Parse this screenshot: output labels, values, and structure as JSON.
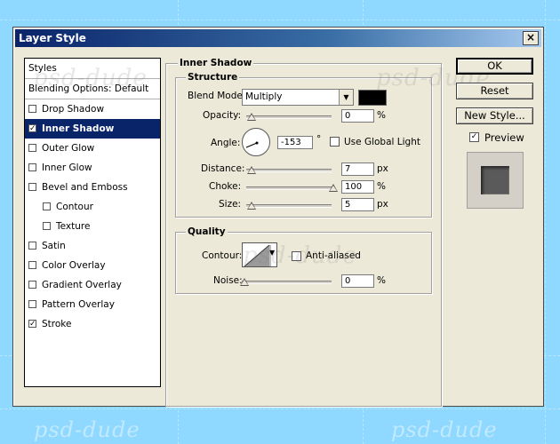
{
  "watermark": "psd-dude",
  "window": {
    "title": "Layer Style",
    "close_symbol": "×"
  },
  "styles_panel": {
    "header": "Styles",
    "blending_options": "Blending Options: Default",
    "items": [
      {
        "label": "Drop Shadow",
        "checked": false,
        "selected": false,
        "indent": false
      },
      {
        "label": "Inner Shadow",
        "checked": true,
        "selected": true,
        "indent": false
      },
      {
        "label": "Outer Glow",
        "checked": false,
        "selected": false,
        "indent": false
      },
      {
        "label": "Inner Glow",
        "checked": false,
        "selected": false,
        "indent": false
      },
      {
        "label": "Bevel and Emboss",
        "checked": false,
        "selected": false,
        "indent": false
      },
      {
        "label": "Contour",
        "checked": false,
        "selected": false,
        "indent": true
      },
      {
        "label": "Texture",
        "checked": false,
        "selected": false,
        "indent": true
      },
      {
        "label": "Satin",
        "checked": false,
        "selected": false,
        "indent": false
      },
      {
        "label": "Color Overlay",
        "checked": false,
        "selected": false,
        "indent": false
      },
      {
        "label": "Gradient Overlay",
        "checked": false,
        "selected": false,
        "indent": false
      },
      {
        "label": "Pattern Overlay",
        "checked": false,
        "selected": false,
        "indent": false
      },
      {
        "label": "Stroke",
        "checked": true,
        "selected": false,
        "indent": false
      }
    ]
  },
  "inner_shadow": {
    "title": "Inner Shadow",
    "structure": {
      "title": "Structure",
      "blend_mode_label": "Blend Mode:",
      "blend_mode_value": "Multiply",
      "blend_color": "#000000",
      "opacity_label": "Opacity:",
      "opacity_value": "0",
      "opacity_unit": "%",
      "angle_label": "Angle:",
      "angle_value": "-153",
      "angle_unit": "°",
      "use_global_light_label": "Use Global Light",
      "distance_label": "Distance:",
      "distance_value": "7",
      "distance_unit": "px",
      "choke_label": "Choke:",
      "choke_value": "100",
      "choke_unit": "%",
      "size_label": "Size:",
      "size_value": "5",
      "size_unit": "px"
    },
    "quality": {
      "title": "Quality",
      "contour_label": "Contour:",
      "anti_aliased_label": "Anti-aliased",
      "noise_label": "Noise:",
      "noise_value": "0",
      "noise_unit": "%"
    }
  },
  "buttons": {
    "ok": "OK",
    "reset": "Reset",
    "new_style": "New Style...",
    "preview_label": "Preview",
    "preview_checked": true
  }
}
